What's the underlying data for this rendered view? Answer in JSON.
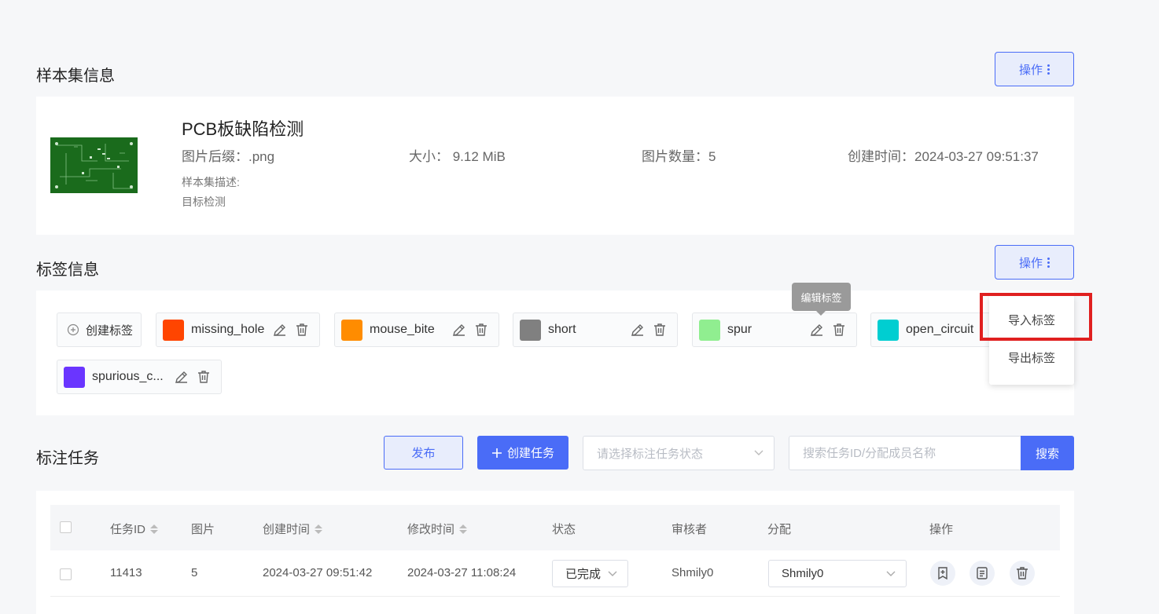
{
  "dataset_section": {
    "title": "样本集信息",
    "action_label": "操作",
    "name": "PCB板缺陷检测",
    "suffix": "图片后缀：.png",
    "size": "大小：  9.12 MiB",
    "count": "图片数量：5",
    "created": "创建时间：2024-03-27 09:51:37",
    "desc_label": "样本集描述:",
    "desc_value": "目标检测"
  },
  "label_section": {
    "title": "标签信息",
    "action_label": "操作",
    "create_label": "创建标签",
    "tooltip": "编辑标签",
    "labels": [
      {
        "name": "missing_hole",
        "color": "#ff4500"
      },
      {
        "name": "mouse_bite",
        "color": "#ff8c00"
      },
      {
        "name": "short",
        "color": "#808080"
      },
      {
        "name": "spur",
        "color": "#90ee90"
      },
      {
        "name": "open_circuit",
        "color": "#00ced1"
      },
      {
        "name": "spurious_c...",
        "color": "#6a35ff"
      }
    ],
    "dropdown": {
      "import": "导入标签",
      "export": "导出标签"
    }
  },
  "task_section": {
    "title": "标注任务",
    "publish_label": "发布",
    "create_task_label": "创建任务",
    "status_placeholder": "请选择标注任务状态",
    "search_placeholder": "搜索任务ID/分配成员名称",
    "search_label": "搜索",
    "columns": {
      "id": "任务ID",
      "images": "图片",
      "created": "创建时间",
      "modified": "修改时间",
      "status": "状态",
      "reviewer": "审核者",
      "assign": "分配",
      "actions": "操作"
    },
    "rows": [
      {
        "id": "11413",
        "images": "5",
        "created": "2024-03-27 09:51:42",
        "modified": "2024-03-27 11:08:24",
        "status": "已完成",
        "reviewer": "Shmily0",
        "assign": "Shmily0"
      }
    ]
  },
  "colors": {
    "accent": "#4a6cf7",
    "highlight": "#e02020"
  }
}
